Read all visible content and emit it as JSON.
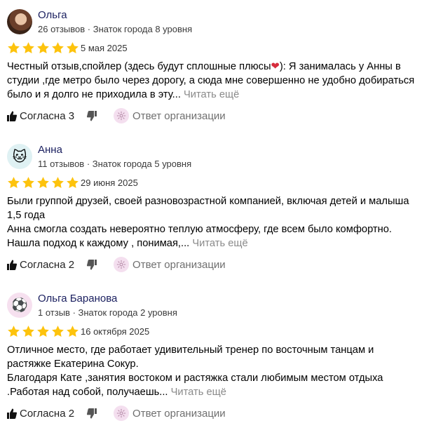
{
  "reviews": [
    {
      "name": "Ольга",
      "meta": "26 отзывов · Знаток города 8 уровня",
      "avatar": "user-photo",
      "date": "5 мая 2025",
      "rating": 5,
      "text_lines": [
        "Честный отзыв,спойлер (здесь будут сплошные плюсы",
        "): Я занималась у Анны в",
        "студии ,где метро было через дорогу, а сюда мне совершенно не удобно добираться",
        "было и я долго не приходила в эту... "
      ],
      "emoji": "heart",
      "emoji_glyph": "❤",
      "more": "Читать ещё",
      "agree_label": "Согласна 3",
      "org_reply": "Ответ организации"
    },
    {
      "name": "Анна",
      "meta": "11 отзывов · Знаток города 5 уровня",
      "avatar": "cat",
      "avatar_glyph": "🐱",
      "date": "29 июня 2025",
      "rating": 5,
      "text_lines": [
        "Были группой друзей, своей разновозрастной компанией, включая детей и малыша",
        "1,5 года",
        "Анна смогла создать невероятно теплую атмосферу, где всем было комфортно.",
        "Нашла подход к каждому , понимая,... "
      ],
      "more": "Читать ещё",
      "agree_label": "Согласна 2",
      "org_reply": "Ответ организации"
    },
    {
      "name": "Ольга Баранова",
      "meta": "1 отзыв · Знаток города 2 уровня",
      "avatar": "soccer-ball",
      "avatar_glyph": "⚽",
      "date": "16 октября 2025",
      "rating": 5,
      "text_lines": [
        "Отличное место, где работает удивительный тренер по восточным танцам и",
        "растяжке Екатерина Сокур.",
        "Благодаря Кате ,занятия востоком и растяжка стали любимым местом отдыха",
        ".Работая над собой, получаешь... "
      ],
      "more": "Читать ещё",
      "agree_label": "Согласна 2",
      "org_reply": "Ответ организации"
    }
  ],
  "colors": {
    "star": "#fdc30d",
    "author_name": "#1a1f5f",
    "muted_text": "#8a8a8a",
    "org_icon_bg": "#f4dfef"
  }
}
